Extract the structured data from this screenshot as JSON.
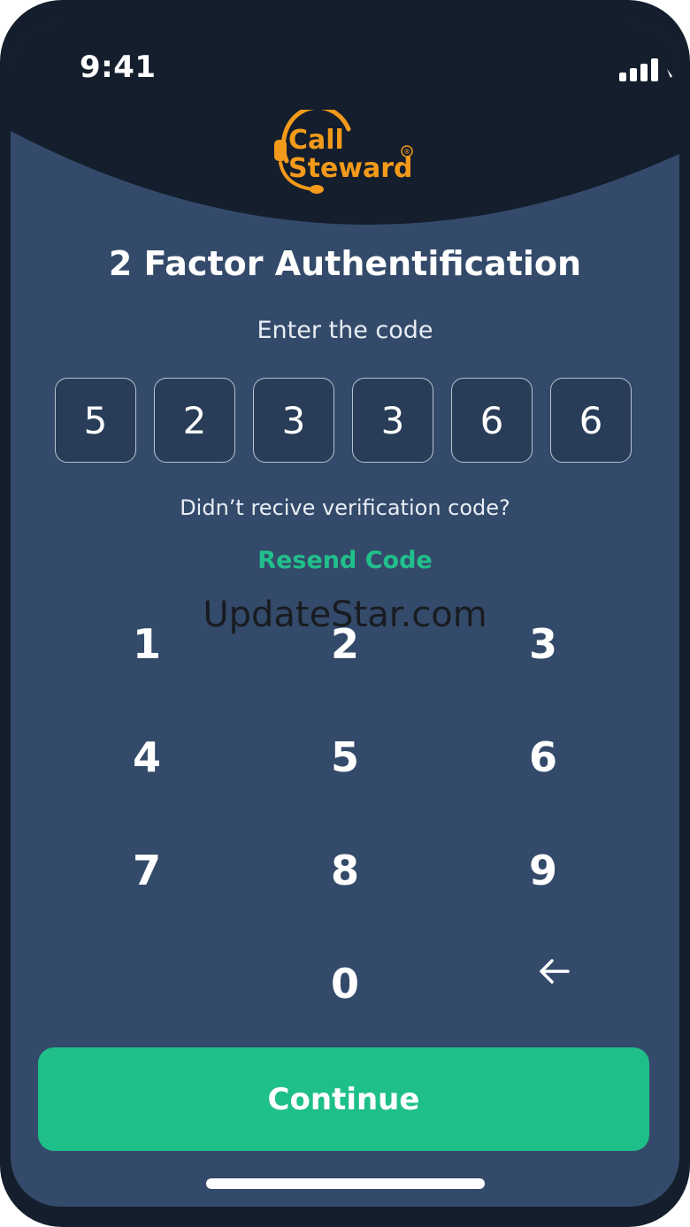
{
  "status_bar": {
    "time": "9:41",
    "signal_icon": "signal-bars-icon",
    "wifi_icon": "wifi-icon"
  },
  "brand": {
    "logo_line1": "Call",
    "logo_line2": "Steward",
    "registered_mark": "®",
    "logo_color": "#f39a1b"
  },
  "auth": {
    "title": "2 Factor Authentification",
    "subtitle": "Enter the code",
    "code_digits": [
      "5",
      "2",
      "3",
      "3",
      "6",
      "6"
    ],
    "hint": "Didn’t recive verification code?",
    "resend_label": "Resend Code"
  },
  "keypad": {
    "keys": [
      "1",
      "2",
      "3",
      "4",
      "5",
      "6",
      "7",
      "8",
      "9",
      "0"
    ],
    "backspace_icon": "backspace-arrow-icon"
  },
  "watermark": "UpdateStar.com",
  "actions": {
    "continue_label": "Continue"
  },
  "colors": {
    "background": "#344a6a",
    "header": "#141e2c",
    "accent": "#1fbf8a",
    "brand_orange": "#f39a1b"
  }
}
